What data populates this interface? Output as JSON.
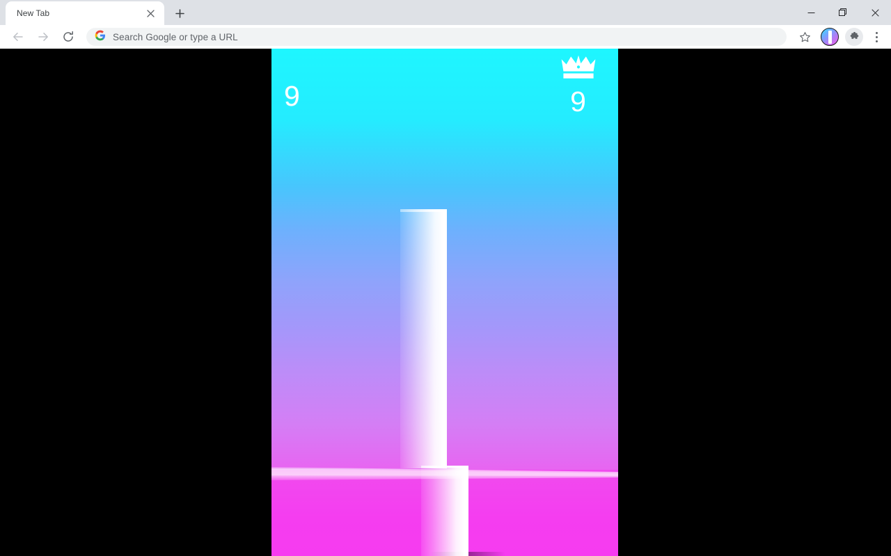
{
  "window": {
    "controls": [
      {
        "name": "minimize-button",
        "icon": "minimize-icon"
      },
      {
        "name": "maximize-button",
        "icon": "maximize-icon"
      },
      {
        "name": "close-button",
        "icon": "close-icon"
      }
    ]
  },
  "tabstrip": {
    "tabs": [
      {
        "title": "New Tab",
        "close_icon": "close-icon"
      }
    ],
    "new_tab_label": "+"
  },
  "toolbar": {
    "back_icon": "arrow-left-icon",
    "forward_icon": "arrow-right-icon",
    "reload_icon": "reload-icon",
    "search_engine_icon": "google-g-icon",
    "omnibox_placeholder": "Search Google or type a URL",
    "omnibox_value": "",
    "bookmark_icon": "star-icon",
    "profile_icon": "avatar",
    "extensions_icon": "puzzle-piece-icon",
    "menu_icon": "three-dot-menu-icon"
  },
  "game": {
    "score": "9",
    "high_score": "9",
    "crown_icon": "crown-icon",
    "colors": {
      "sky_top": "#1ef6ff",
      "sky_mid": "#a497fa",
      "ground": "#f53df0",
      "pillar": "#ffffff"
    }
  }
}
